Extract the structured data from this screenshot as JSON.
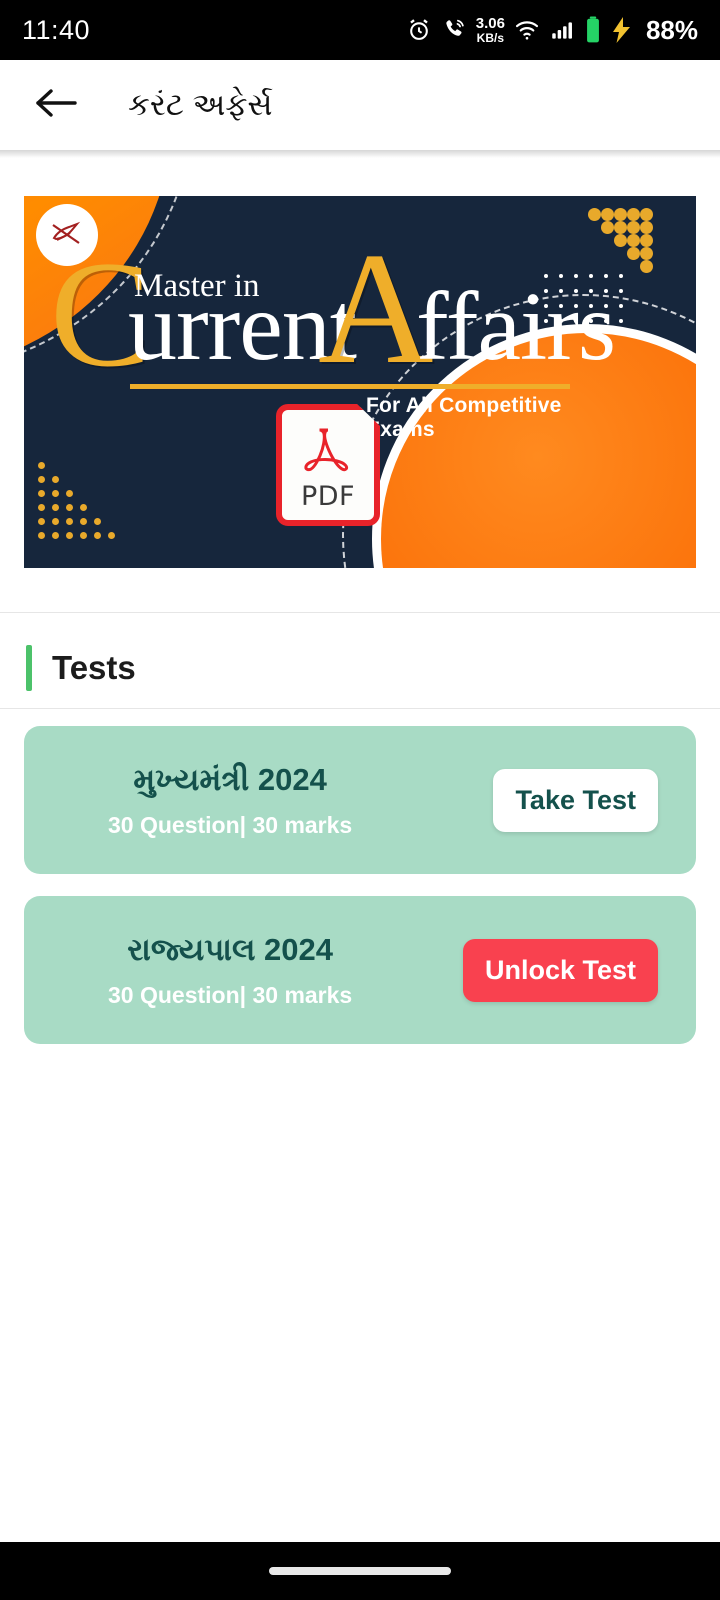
{
  "statusbar": {
    "time": "11:40",
    "icons": [
      "alarm-icon",
      "call-icon",
      "wifi-icon",
      "cellular-signal-icon",
      "battery-icon",
      "charging-bolt-icon"
    ],
    "network_speed_value": "3.06",
    "network_speed_unit": "KB/s",
    "battery_percent": "88%"
  },
  "appbar": {
    "back_icon": "back-arrow-icon",
    "title": "કરંટ અફેર્સ"
  },
  "banner": {
    "logo_badge_icon": "hand-writing-pen-logo-icon",
    "master_in": "Master in",
    "word_c": "C",
    "word_urrent": "urrent",
    "word_a": "A",
    "word_ffairs": "ffairs",
    "subtitle": "For All Competitive Exams",
    "pdf_label": "PDF",
    "pdf_icon": "pdf-file-icon",
    "colors": {
      "navy": "#16263c",
      "gold": "#efae2a",
      "orange": "#fb7109",
      "white": "#ffffff"
    }
  },
  "tests_section": {
    "title": "Tests",
    "accent_color": "#4cc26a",
    "cards": [
      {
        "title": "મુખ્યમંત્રી 2024",
        "meta": "30 Question| 30 marks",
        "button_label": "Take Test",
        "button_style": "light",
        "button_color": "#ffffff",
        "card_color": "#a8dbc5"
      },
      {
        "title": "રાજ્યપાલ 2024",
        "meta": "30 Question| 30 marks",
        "button_label": "Unlock Test",
        "button_style": "danger",
        "button_color": "#f9414f",
        "card_color": "#a8dbc5"
      }
    ]
  },
  "navbar": {
    "gesture_pill": "home-gesture-pill"
  }
}
